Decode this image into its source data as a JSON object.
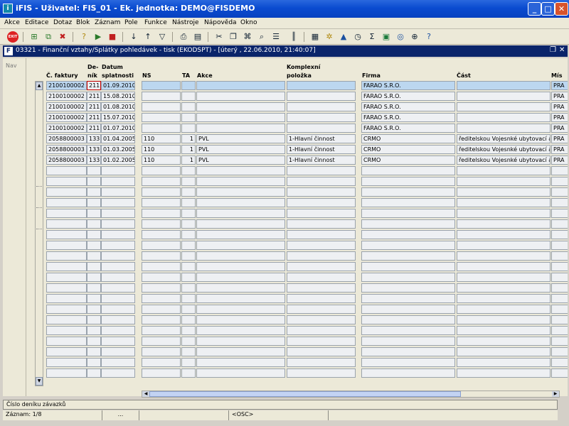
{
  "window": {
    "title": "iFIS - Uživatel: FIS_01 - Ek. jednotka: DEMO@FISDEMO"
  },
  "menu": [
    "Akce",
    "Editace",
    "Dotaz",
    "Blok",
    "Záznam",
    "Pole",
    "Funkce",
    "Nástroje",
    "Nápověda",
    "Okno"
  ],
  "toolbar": {
    "exit_label": "EXIT"
  },
  "form": {
    "title": "03321 - Finanční vztahy/Splátky pohledávek - tisk (EKODSPT) - [úterý  , 22.06.2010, 21:40:07]"
  },
  "nav": {
    "label": "Nav"
  },
  "columns": {
    "faktura": "Č. faktury",
    "denik_1": "De-",
    "denik_2": "ník",
    "datum_1": "Datum",
    "datum_2": "splatnosti",
    "ns": "NS",
    "ta": "TA",
    "akce": "Akce",
    "kp_1": "Komplexní",
    "kp_2": "položka",
    "firma": "Firma",
    "cast": "Část",
    "misto": "Mís"
  },
  "rows": [
    {
      "faktura": "2100100002",
      "denik": "211",
      "datum": "01.09.2010",
      "ns": "",
      "ta": "",
      "akce": "",
      "kp": "",
      "firma": "FARAO S.R.O.",
      "cast": "",
      "misto": "PRA"
    },
    {
      "faktura": "2100100002",
      "denik": "211",
      "datum": "15.08.2010",
      "ns": "",
      "ta": "",
      "akce": "",
      "kp": "",
      "firma": "FARAO S.R.O.",
      "cast": "",
      "misto": "PRA"
    },
    {
      "faktura": "2100100002",
      "denik": "211",
      "datum": "01.08.2010",
      "ns": "",
      "ta": "",
      "akce": "",
      "kp": "",
      "firma": "FARAO S.R.O.",
      "cast": "",
      "misto": "PRA"
    },
    {
      "faktura": "2100100002",
      "denik": "211",
      "datum": "15.07.2010",
      "ns": "",
      "ta": "",
      "akce": "",
      "kp": "",
      "firma": "FARAO S.R.O.",
      "cast": "",
      "misto": "PRA"
    },
    {
      "faktura": "2100100002",
      "denik": "211",
      "datum": "01.07.2010",
      "ns": "",
      "ta": "",
      "akce": "",
      "kp": "",
      "firma": "FARAO S.R.O.",
      "cast": "",
      "misto": "PRA"
    },
    {
      "faktura": "2058800003",
      "denik": "133",
      "datum": "01.04.2005",
      "ns": "110",
      "ta": "1",
      "akce": "PVL",
      "kp": "1-Hlavní činnost",
      "firma": "CRMO",
      "cast": "ředitelskou Vojesnké ubytovací a s",
      "misto": "PRA"
    },
    {
      "faktura": "2058800003",
      "denik": "133",
      "datum": "01.03.2005",
      "ns": "110",
      "ta": "1",
      "akce": "PVL",
      "kp": "1-Hlavní činnost",
      "firma": "CRMO",
      "cast": "ředitelskou Vojesnké ubytovací a s",
      "misto": "PRA"
    },
    {
      "faktura": "2058800003",
      "denik": "133",
      "datum": "01.02.2005",
      "ns": "110",
      "ta": "1",
      "akce": "PVL",
      "kp": "1-Hlavní činnost",
      "firma": "CRMO",
      "cast": "ředitelskou Vojesnké ubytovací a s",
      "misto": "PRA"
    }
  ],
  "status": {
    "hint": "Číslo deníku závazků",
    "record": "Záznam: 1/8",
    "mode": "...",
    "osc": "<OSC>"
  }
}
